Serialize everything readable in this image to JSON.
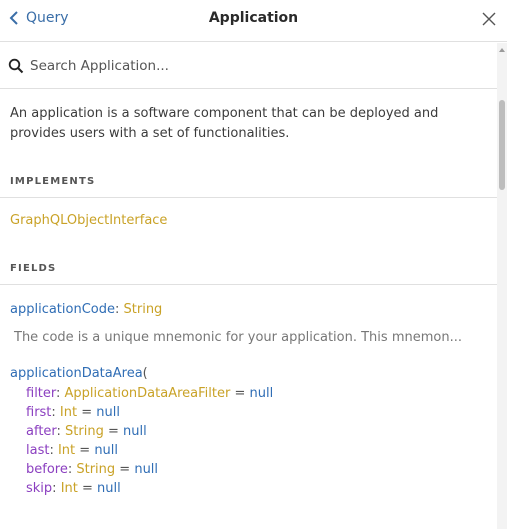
{
  "header": {
    "back_label": "Query",
    "title": "Application"
  },
  "search": {
    "placeholder": "Search Application..."
  },
  "description": "An application is a software component that can be deployed and provides users with a set of functionalities.",
  "implements": {
    "heading": "IMPLEMENTS",
    "items": [
      "GraphQLObjectInterface"
    ]
  },
  "fields": {
    "heading": "FIELDS",
    "items": [
      {
        "name": "applicationCode",
        "type": "String",
        "description": "The code is a unique mnemonic for your application. This mnemon..."
      },
      {
        "name": "applicationDataArea",
        "open_paren": "(",
        "args": [
          {
            "name": "filter",
            "type": "ApplicationDataAreaFilter",
            "default": "null"
          },
          {
            "name": "first",
            "type": "Int",
            "default": "null"
          },
          {
            "name": "after",
            "type": "String",
            "default": "null"
          },
          {
            "name": "last",
            "type": "Int",
            "default": "null"
          },
          {
            "name": "before",
            "type": "String",
            "default": "null"
          },
          {
            "name": "skip",
            "type": "Int",
            "default": "null"
          }
        ]
      }
    ]
  },
  "colors": {
    "link_blue": "#3a6ea8",
    "field_blue": "#2f6db5",
    "type_gold": "#c9a227",
    "arg_purple": "#8b3fc0"
  },
  "icons": {
    "back": "chevron-left-icon",
    "close": "close-icon",
    "search": "search-icon"
  }
}
